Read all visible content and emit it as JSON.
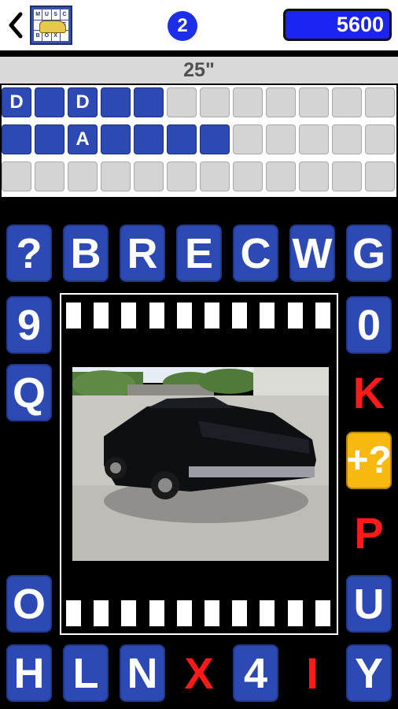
{
  "header": {
    "logo_letters": [
      "M",
      "U",
      "S",
      "C",
      "",
      "",
      "L",
      "E",
      "B",
      "O",
      "X",
      ""
    ],
    "level": "2",
    "coins": "5600"
  },
  "timer": "25\"",
  "answer_rows": [
    [
      "D",
      "",
      "D",
      "",
      "",
      "",
      "",
      "",
      "",
      "",
      "",
      ""
    ],
    [
      "",
      "",
      "A",
      "",
      "",
      "",
      "",
      "",
      "",
      "",
      "",
      ""
    ],
    [
      "",
      "",
      "",
      "",
      "",
      "",
      "",
      "",
      "",
      "",
      "",
      ""
    ]
  ],
  "answer_filled": [
    [
      true,
      true,
      true,
      true,
      true,
      false,
      false,
      false,
      false,
      false,
      false,
      false
    ],
    [
      true,
      true,
      true,
      true,
      true,
      true,
      true,
      false,
      false,
      false,
      false,
      false
    ],
    [
      false,
      false,
      false,
      false,
      false,
      false,
      false,
      false,
      false,
      false,
      false,
      false
    ]
  ],
  "keys": {
    "top": [
      "?",
      "B",
      "R",
      "E",
      "C",
      "W",
      "G"
    ],
    "left": [
      "9",
      "Q",
      "O"
    ],
    "right": [
      "0",
      "K",
      "+?",
      "P",
      "U"
    ],
    "bottom": [
      "H",
      "L",
      "N",
      "X",
      "4",
      "I",
      "Y"
    ]
  },
  "colors": {
    "key_blue": "#2d4ab4",
    "coins_blue": "#1d24f2",
    "letter_red": "#ff1a1a",
    "hint_yellow": "#f7b90f"
  },
  "image": {
    "subject": "black classic muscle car"
  }
}
